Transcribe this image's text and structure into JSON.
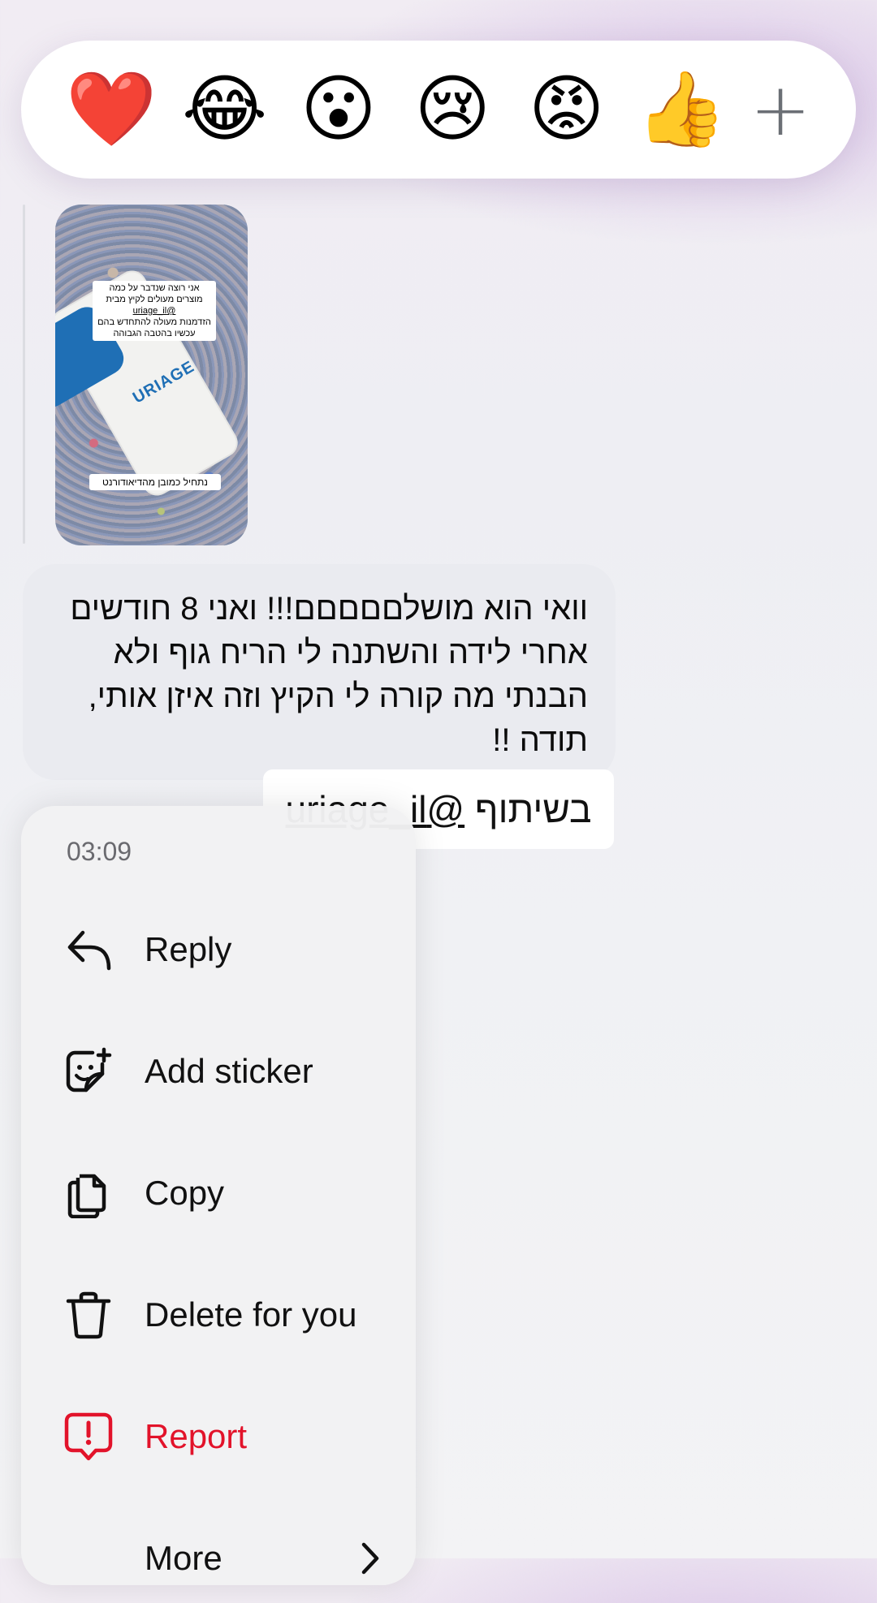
{
  "reactions": [
    "❤️",
    "😂",
    "😮",
    "😢",
    "😡",
    "👍"
  ],
  "reaction_add_label": "+",
  "story": {
    "caption_lines": [
      "אני רוצה שנדבר על כמה",
      "מוצרים מעולים לקיץ מבית",
      "@uriage_il",
      "הזדמנות מעולה להתחדש בהם",
      "עכשיו בהטבה הגבוהה"
    ],
    "brand": "URIAGE",
    "bottom_caption": "נתחיל כמובן מהדיאודורנט"
  },
  "message": {
    "text": "וואי הוא מושלםםםםם!!! ואני 8 חודשים אחרי לידה והשתנה לי הריח גוף ולא הבנתי מה קורה לי הקיץ וזה איזן אותי, תודה !!"
  },
  "mention": {
    "prefix": "בשיתוף",
    "handle": "@uriage_il"
  },
  "menu": {
    "time": "03:09",
    "items": [
      {
        "label": "Reply",
        "icon": "reply-icon"
      },
      {
        "label": "Add sticker",
        "icon": "sticker-icon"
      },
      {
        "label": "Copy",
        "icon": "copy-icon"
      },
      {
        "label": "Delete for you",
        "icon": "trash-icon"
      },
      {
        "label": "Report",
        "icon": "report-icon"
      },
      {
        "label": "More",
        "icon": "chevron-right-icon"
      }
    ]
  },
  "colors": {
    "danger": "#e2132a",
    "bubble": "#eaebf0"
  }
}
